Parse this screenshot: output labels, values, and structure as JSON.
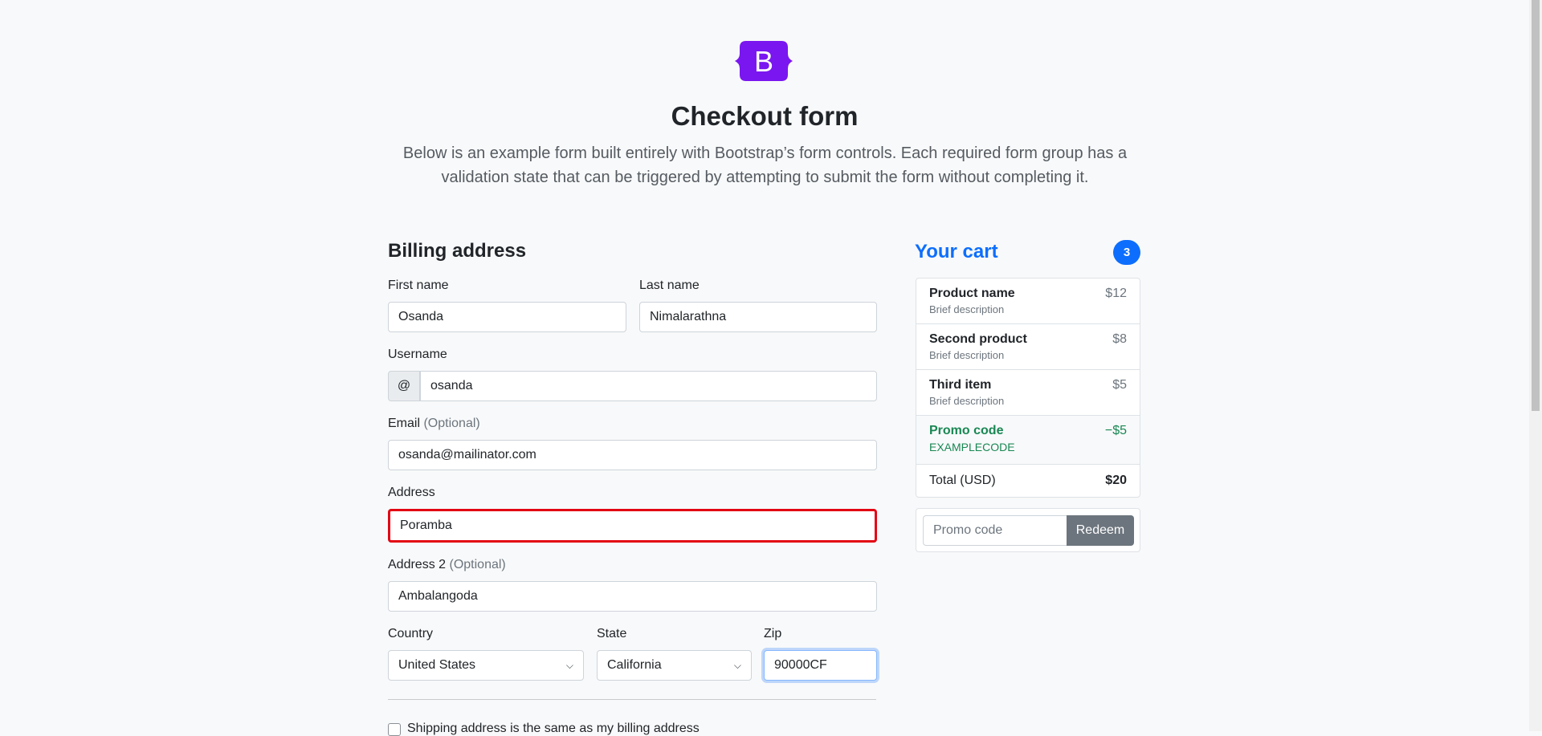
{
  "header": {
    "logo_letter": "B",
    "title": "Checkout form",
    "lead": "Below is an example form built entirely with Bootstrap’s form controls. Each required form group has a validation state that can be triggered by attempting to submit the form without completing it."
  },
  "billing": {
    "heading": "Billing address",
    "first_name": {
      "label": "First name",
      "value": "Osanda"
    },
    "last_name": {
      "label": "Last name",
      "value": "Nimalarathna"
    },
    "username": {
      "label": "Username",
      "prefix": "@",
      "value": "osanda"
    },
    "email": {
      "label": "Email",
      "optional": "(Optional)",
      "value": "osanda@mailinator.com"
    },
    "address": {
      "label": "Address",
      "value": "Poramba"
    },
    "address2": {
      "label": "Address 2",
      "optional": "(Optional)",
      "value": "Ambalangoda"
    },
    "country": {
      "label": "Country",
      "value": "United States"
    },
    "state": {
      "label": "State",
      "value": "California"
    },
    "zip": {
      "label": "Zip",
      "value": "90000CF"
    },
    "shipping_same": {
      "label": "Shipping address is the same as my billing address"
    }
  },
  "cart": {
    "title": "Your cart",
    "count": "3",
    "items": [
      {
        "name": "Product name",
        "desc": "Brief description",
        "price": "$12"
      },
      {
        "name": "Second product",
        "desc": "Brief description",
        "price": "$8"
      },
      {
        "name": "Third item",
        "desc": "Brief description",
        "price": "$5"
      }
    ],
    "promo": {
      "name": "Promo code",
      "code": "EXAMPLECODE",
      "amount": "−$5"
    },
    "total": {
      "label": "Total (USD)",
      "value": "$20"
    },
    "promo_form": {
      "placeholder": "Promo code",
      "button": "Redeem"
    }
  },
  "colors": {
    "primary": "#0d6efd",
    "success": "#198754",
    "invalid_border": "#e30613",
    "logo": "#7952b3"
  }
}
